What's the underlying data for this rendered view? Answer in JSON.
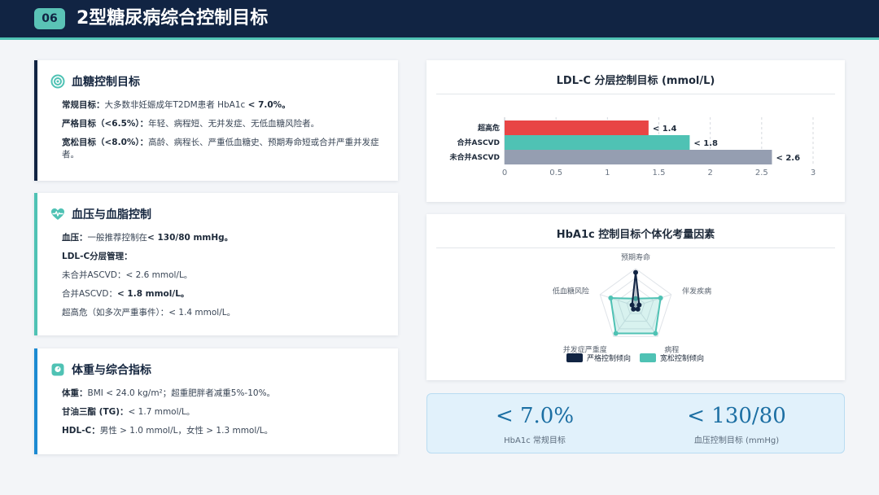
{
  "header": {
    "number": "06",
    "title": "2型糖尿病综合控制目标"
  },
  "colors": {
    "navy": "#112443",
    "teal": "#4fc2b4",
    "red": "#e84545",
    "gray": "#959eb1",
    "blue": "#1c8ad2"
  },
  "glucose": {
    "title": "血糖控制目标",
    "icon": "target-icon",
    "lines": [
      {
        "label": "常规目标：",
        "text": "大多数非妊娠成年T2DM患者 HbA1c ",
        "strong": "< 7.0%。"
      },
      {
        "label": "严格目标（<6.5%）：",
        "text": "年轻、病程短、无并发症、无低血糖风险者。"
      },
      {
        "label": "宽松目标（<8.0%）：",
        "text": "高龄、病程长、严重低血糖史、预期寿命短或合并严重并发症者。"
      }
    ]
  },
  "bp_lipid": {
    "title": "血压与血脂控制",
    "icon": "heart-pulse-icon",
    "lines": [
      {
        "label": "血压：",
        "text": "一般推荐控制在",
        "strong": "< 130/80 mmHg。"
      },
      {
        "label": "LDL-C分层管理：",
        "text": ""
      },
      {
        "label": "",
        "text": "未合并ASCVD：< 2.6 mmol/L。"
      },
      {
        "label": "",
        "text": "合并ASCVD：",
        "strong": "< 1.8 mmol/L。"
      },
      {
        "label": "",
        "text": "超高危（如多次严重事件）：< 1.4 mmol/L。"
      }
    ]
  },
  "weight": {
    "title": "体重与综合指标",
    "icon": "scale-icon",
    "lines": [
      {
        "label": "体重：",
        "text": "BMI < 24.0 kg/m²；超重肥胖者减重5%-10%。"
      },
      {
        "label": "甘油三酯 (TG)：",
        "text": "< 1.7 mmol/L。"
      },
      {
        "label": "HDL-C：",
        "text": "男性 > 1.0 mmol/L，女性 > 1.3 mmol/L。"
      }
    ]
  },
  "chart_data": [
    {
      "type": "bar",
      "orientation": "horizontal",
      "title": "LDL-C 分层控制目标 (mmol/L)",
      "categories": [
        "超高危",
        "合并ASCVD",
        "未合并ASCVD"
      ],
      "values": [
        1.4,
        1.8,
        2.6
      ],
      "data_labels": [
        "< 1.4",
        "< 1.8",
        "< 2.6"
      ],
      "colors": [
        "#e84545",
        "#4fc2b4",
        "#959eb1"
      ],
      "xlim": [
        0,
        3
      ],
      "xticks": [
        "0",
        "0.5",
        "1",
        "1.5",
        "2",
        "2.5",
        "3"
      ],
      "grid": true
    },
    {
      "type": "radar",
      "title": "HbA1c 控制目标个体化考量因素",
      "axes": [
        "预期寿命",
        "伴发疾病",
        "病程",
        "并发症严重度",
        "低血糖风险"
      ],
      "series": [
        {
          "name": "严格控制倾向",
          "values": [
            0.9,
            0.1,
            0.1,
            0.1,
            0.1
          ],
          "color": "#112443"
        },
        {
          "name": "宽松控制倾向",
          "values": [
            0.2,
            0.7,
            0.9,
            0.9,
            0.7
          ],
          "color": "#4fc2b4"
        }
      ],
      "legend": "bottom"
    }
  ],
  "kpis": [
    {
      "value": "< 7.0%",
      "label": "HbA1c 常规目标"
    },
    {
      "value": "< 130/80",
      "label": "血压控制目标 (mmHg)"
    }
  ]
}
